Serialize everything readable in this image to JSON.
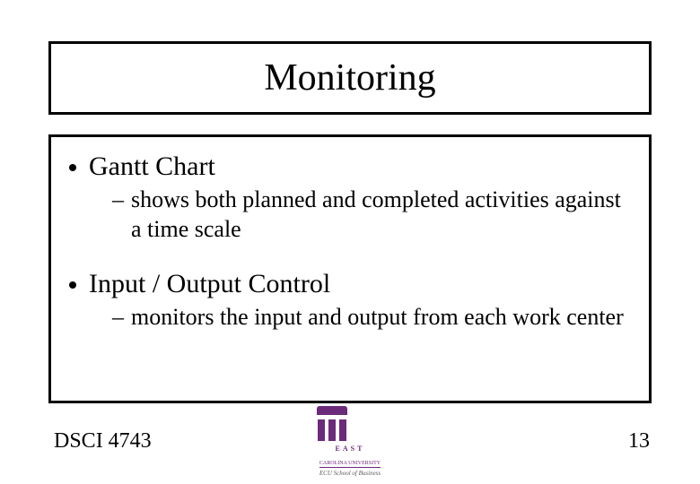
{
  "title": "Monitoring",
  "bullets": [
    {
      "label": "Gantt Chart",
      "sub": "shows both planned and completed activities against a time scale"
    },
    {
      "label": "Input / Output Control",
      "sub": "monitors the input and output from each work center"
    }
  ],
  "footer": {
    "left": "DSCI 4743",
    "page": "13"
  },
  "logo": {
    "line1": "EAST",
    "line2": "CAROLINA UNIVERSITY",
    "line3": "ECU School of Business"
  }
}
